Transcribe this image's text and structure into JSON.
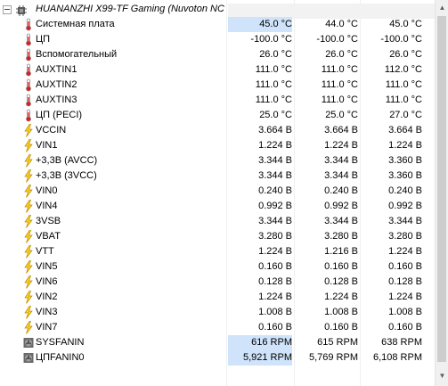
{
  "header": {
    "device_label": "HUANANZHI X99-TF Gaming (Nuvoton NC...",
    "device_icon": "chip-icon",
    "expander": "collapse-toggle-icon"
  },
  "rows": [
    {
      "label": "Системная плата",
      "icon": "thermometer-icon",
      "current": "45.0 °C",
      "min": "44.0 °C",
      "max": "45.0 °C",
      "highlight": true
    },
    {
      "label": "ЦП",
      "icon": "thermometer-icon",
      "current": "-100.0 °C",
      "min": "-100.0 °C",
      "max": "-100.0 °C",
      "highlight": false
    },
    {
      "label": "Вспомогательный",
      "icon": "thermometer-icon",
      "current": "26.0 °C",
      "min": "26.0 °C",
      "max": "26.0 °C",
      "highlight": false
    },
    {
      "label": "AUXTIN1",
      "icon": "thermometer-icon",
      "current": "111.0 °C",
      "min": "111.0 °C",
      "max": "112.0 °C",
      "highlight": false
    },
    {
      "label": "AUXTIN2",
      "icon": "thermometer-icon",
      "current": "111.0 °C",
      "min": "111.0 °C",
      "max": "111.0 °C",
      "highlight": false
    },
    {
      "label": "AUXTIN3",
      "icon": "thermometer-icon",
      "current": "111.0 °C",
      "min": "111.0 °C",
      "max": "111.0 °C",
      "highlight": false
    },
    {
      "label": "ЦП (PECI)",
      "icon": "thermometer-icon",
      "current": "25.0 °C",
      "min": "25.0 °C",
      "max": "27.0 °C",
      "highlight": false
    },
    {
      "label": "VCCIN",
      "icon": "lightning-icon",
      "current": "3.664 В",
      "min": "3.664 В",
      "max": "3.664 В",
      "highlight": false
    },
    {
      "label": "VIN1",
      "icon": "lightning-icon",
      "current": "1.224 В",
      "min": "1.224 В",
      "max": "1.224 В",
      "highlight": false
    },
    {
      "label": "+3,3В (AVCC)",
      "icon": "lightning-icon",
      "current": "3.344 В",
      "min": "3.344 В",
      "max": "3.360 В",
      "highlight": false
    },
    {
      "label": "+3,3В (3VCC)",
      "icon": "lightning-icon",
      "current": "3.344 В",
      "min": "3.344 В",
      "max": "3.360 В",
      "highlight": false
    },
    {
      "label": "VIN0",
      "icon": "lightning-icon",
      "current": "0.240 В",
      "min": "0.240 В",
      "max": "0.240 В",
      "highlight": false
    },
    {
      "label": "VIN4",
      "icon": "lightning-icon",
      "current": "0.992 В",
      "min": "0.992 В",
      "max": "0.992 В",
      "highlight": false
    },
    {
      "label": "3VSB",
      "icon": "lightning-icon",
      "current": "3.344 В",
      "min": "3.344 В",
      "max": "3.344 В",
      "highlight": false
    },
    {
      "label": "VBAT",
      "icon": "lightning-icon",
      "current": "3.280 В",
      "min": "3.280 В",
      "max": "3.280 В",
      "highlight": false
    },
    {
      "label": "VTT",
      "icon": "lightning-icon",
      "current": "1.224 В",
      "min": "1.216 В",
      "max": "1.224 В",
      "highlight": false
    },
    {
      "label": "VIN5",
      "icon": "lightning-icon",
      "current": "0.160 В",
      "min": "0.160 В",
      "max": "0.160 В",
      "highlight": false
    },
    {
      "label": "VIN6",
      "icon": "lightning-icon",
      "current": "0.128 В",
      "min": "0.128 В",
      "max": "0.128 В",
      "highlight": false
    },
    {
      "label": "VIN2",
      "icon": "lightning-icon",
      "current": "1.224 В",
      "min": "1.224 В",
      "max": "1.224 В",
      "highlight": false
    },
    {
      "label": "VIN3",
      "icon": "lightning-icon",
      "current": "1.008 В",
      "min": "1.008 В",
      "max": "1.008 В",
      "highlight": false
    },
    {
      "label": "VIN7",
      "icon": "lightning-icon",
      "current": "0.160 В",
      "min": "0.160 В",
      "max": "0.160 В",
      "highlight": false
    },
    {
      "label": "SYSFANIN",
      "icon": "fan-icon",
      "current": "616 RPM",
      "min": "615 RPM",
      "max": "638 RPM",
      "highlight": true
    },
    {
      "label": "ЦПFANIN0",
      "icon": "fan-icon",
      "current": "5,921 RPM",
      "min": "5,769 RPM",
      "max": "6,108 RPM",
      "highlight": true
    }
  ],
  "scrollbar": {
    "up_arrow": "▲",
    "down_arrow": "▼"
  }
}
